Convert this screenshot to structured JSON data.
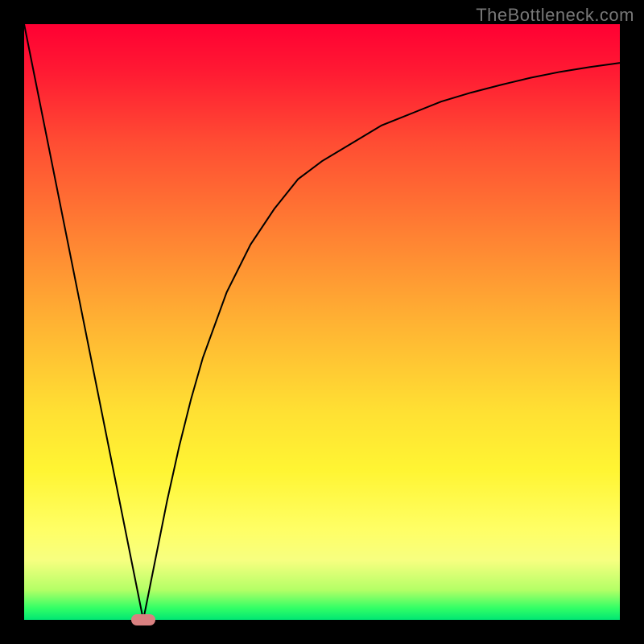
{
  "attribution": "TheBottleneck.com",
  "chart_data": {
    "type": "line",
    "title": "",
    "xlabel": "",
    "ylabel": "",
    "xlim": [
      0,
      100
    ],
    "ylim": [
      0,
      100
    ],
    "x": [
      0,
      2,
      4,
      6,
      8,
      10,
      12,
      14,
      16,
      18,
      19,
      20,
      21,
      22,
      24,
      26,
      28,
      30,
      34,
      38,
      42,
      46,
      50,
      55,
      60,
      65,
      70,
      75,
      80,
      85,
      90,
      95,
      100
    ],
    "values": [
      100,
      90,
      80,
      70,
      60,
      50,
      40,
      30,
      20,
      10,
      5,
      0,
      5,
      10,
      20,
      29,
      37,
      44,
      55,
      63,
      69,
      74,
      77,
      80,
      83,
      85,
      87,
      88.5,
      89.8,
      91,
      92,
      92.8,
      93.5
    ],
    "marker": {
      "x": 20,
      "y": 0
    },
    "gradient_stops": [
      {
        "pct": 0,
        "color": "#ff0033"
      },
      {
        "pct": 50,
        "color": "#ffb233"
      },
      {
        "pct": 85,
        "color": "#ffff66"
      },
      {
        "pct": 100,
        "color": "#00e673"
      }
    ]
  }
}
